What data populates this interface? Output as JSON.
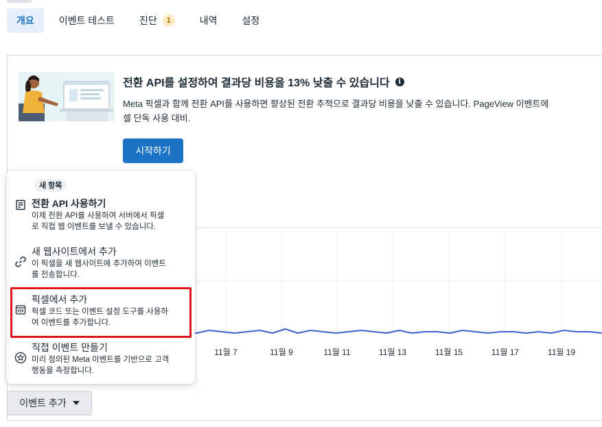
{
  "tabs": [
    {
      "label": "개요",
      "active": true
    },
    {
      "label": "이벤트 테스트"
    },
    {
      "label": "진단",
      "badge": "1"
    },
    {
      "label": "내역"
    },
    {
      "label": "설정"
    }
  ],
  "promo": {
    "title": "전환 API를 설정하여 결과당 비용을 13% 낮출 수 있습니다",
    "info_icon": "info-icon",
    "description": "Meta 픽셀과 함께 전환 API를 사용하면 향상된 전환 추적으로 결과당 비용을 낮출 수 있습니다. PageView 이벤트에 대해 픽셀 단독 사용 대비.",
    "description_line1": "Meta 픽셀과 함께 전환 API를 사용하면 향상된 전환 추적으로 결과당 비용을 낮출 수 있습니다. PageView 이벤트에",
    "description_line2": "셀 단독 사용 대비.",
    "button_label": "시작하기"
  },
  "chart_data": {
    "type": "line",
    "x_tick_labels": [
      "11월 7",
      "11월 9",
      "11월 11",
      "11월 13",
      "11월 15",
      "11월 17",
      "11월 19"
    ],
    "series": [
      {
        "color": "#3b5fcf",
        "values": [
          4,
          3,
          5,
          3,
          4,
          5,
          4,
          9,
          4,
          3,
          5,
          4,
          3,
          4,
          5,
          3,
          6,
          3,
          5,
          4,
          3,
          4,
          5,
          4,
          3,
          5,
          3,
          4,
          4,
          3,
          5,
          4,
          3,
          4,
          4,
          3,
          4,
          3,
          5,
          4,
          4,
          3
        ]
      }
    ],
    "grid": true
  },
  "menu": {
    "new_badge": "새 항목",
    "items": [
      {
        "icon": "server-icon",
        "title": "전환 API 사용하기",
        "desc": "이제 전환 API를 사용하여 서버에서 픽셀로 직접 웹 이벤트를 보낼 수 있습니다.",
        "desc1": "이제 전환 API를 사용하여 서버에서 픽셀",
        "desc2": "로 직접 웹 이벤트를 보낼 수 있습니다."
      },
      {
        "icon": "link-icon",
        "title": "새 웹사이트에서 추가",
        "desc": "이 픽셀을 새 웹사이트에 추가하여 이벤트를 전송합니다.",
        "desc1": "이 픽셀을 새 웹사이트에 추가하여 이벤트",
        "desc2": "를 전송합니다."
      },
      {
        "icon": "code-icon",
        "title": "픽셀에서 추가",
        "desc": "픽셀 코드 또는 이벤트 설정 도구를 사용하여 이벤트를 추가합니다.",
        "desc1": "픽셀 코드 또는 이벤트 설정 도구를 사용하",
        "desc2": "여 이벤트를 추가합니다."
      },
      {
        "icon": "star-icon",
        "title": "직접 이벤트 만들기",
        "desc": "미리 정의된 Meta 이벤트를 기반으로 고객 행동을 측정합니다.",
        "desc1": "미리 정의된 Meta 이벤트를 기반으로 고객",
        "desc2": "행동을 측정합니다."
      }
    ]
  },
  "add_event_button": "이벤트 추가"
}
